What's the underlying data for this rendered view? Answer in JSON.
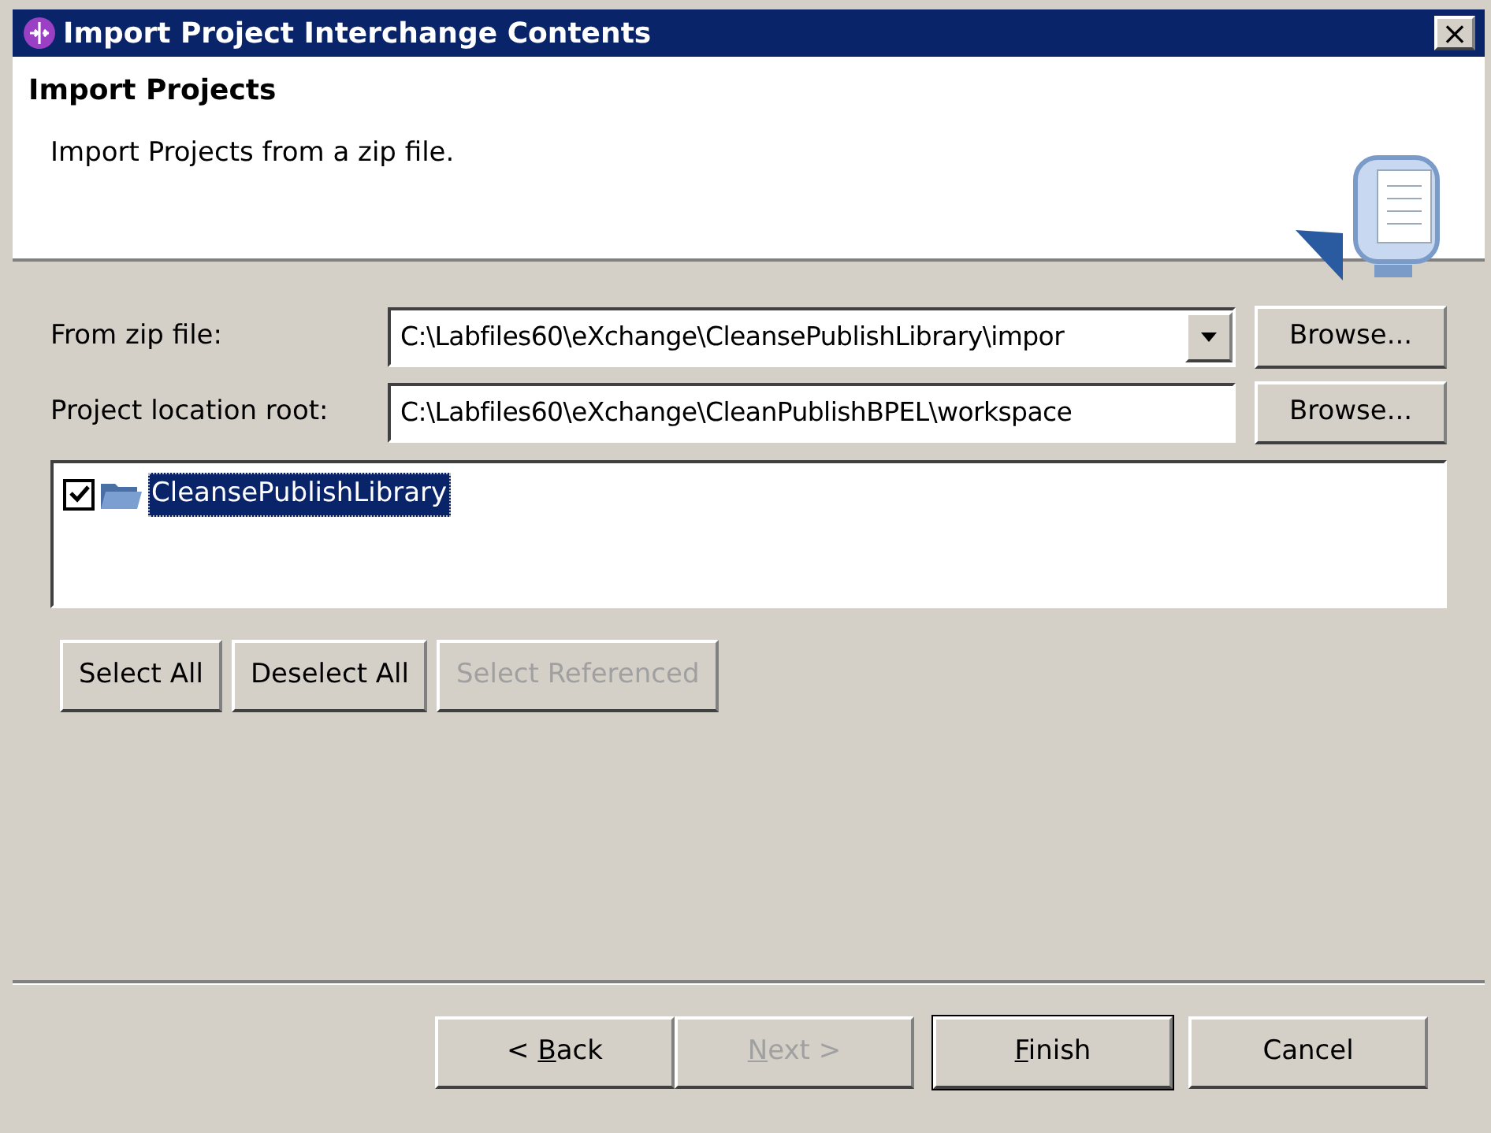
{
  "window": {
    "title": "Import Project Interchange Contents",
    "close": "×"
  },
  "header": {
    "title": "Import Projects",
    "description": "Import Projects from a zip file."
  },
  "fields": [
    {
      "kind": "combo",
      "label": "From zip file:",
      "value": "C:\\Labfiles60\\eXchange\\CleansePublishLibrary\\impor",
      "button": "Browse..."
    },
    {
      "kind": "text",
      "label": "Project location root:",
      "value": "C:\\Labfiles60\\eXchange\\CleanPublishBPEL\\workspace",
      "button": "Browse..."
    }
  ],
  "projects": [
    {
      "name": "CleansePublishLibrary",
      "checked": true,
      "selected": true
    }
  ],
  "selection_buttons": [
    {
      "label": "Select All",
      "disabled": false
    },
    {
      "label": "Deselect All",
      "disabled": false
    },
    {
      "label": "Select Referenced",
      "disabled": true
    }
  ],
  "footer_buttons": [
    {
      "prefix": "< ",
      "key": "B",
      "rest": "ack",
      "disabled": false,
      "default": false
    },
    {
      "key": "N",
      "rest": "ext >",
      "disabled": true,
      "default": false
    },
    {
      "key": "F",
      "rest": "inish",
      "disabled": false,
      "default": true
    },
    {
      "rest": "Cancel",
      "disabled": false,
      "default": false
    }
  ]
}
